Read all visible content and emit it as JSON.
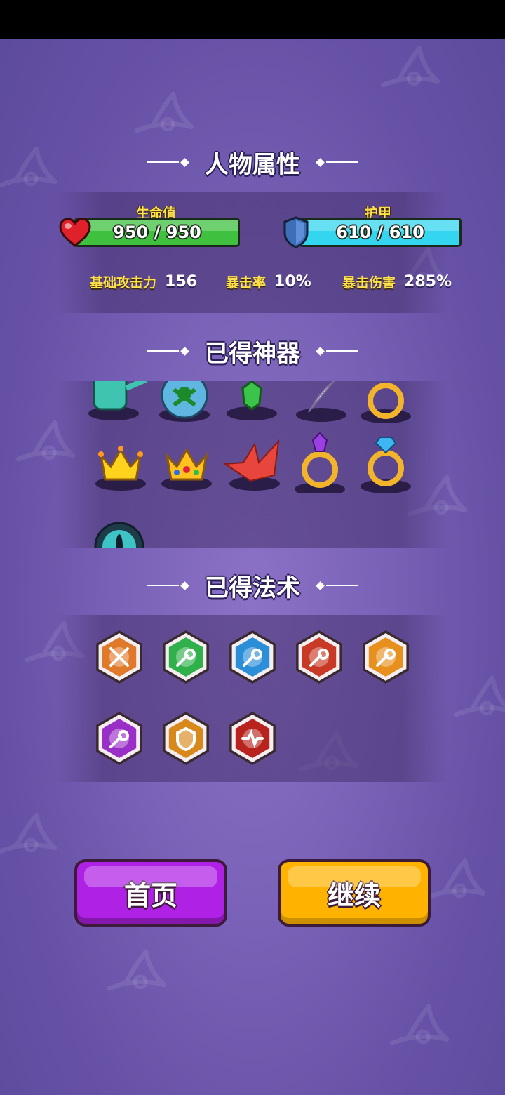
{
  "sections": {
    "attributes": "人物属性",
    "artifacts": "已得神器",
    "spells": "已得法术"
  },
  "health": {
    "label": "生命值",
    "value": "950 / 950",
    "fraction": 1.0,
    "color": "#3fc13f"
  },
  "armor": {
    "label": "护甲",
    "value": "610 / 610",
    "fraction": 1.0,
    "color": "#33d6ee"
  },
  "stats": [
    {
      "key": "基础攻击力",
      "value": "156"
    },
    {
      "key": "暴击率",
      "value": "10%"
    },
    {
      "key": "暴击伤害",
      "value": "285%"
    }
  ],
  "artifacts": [
    "watering-can-icon",
    "poison-orb-icon",
    "green-crystal-icon",
    "feather-icon",
    "gold-ring-icon",
    "gold-crown-icon",
    "jeweled-crown-icon",
    "paper-crane-icon",
    "amethyst-ring-icon",
    "diamond-ring-icon",
    "dragon-eye-icon"
  ],
  "spells": [
    {
      "icon": "crossed-swords-icon",
      "color": "#e07a2a"
    },
    {
      "icon": "green-comet-icon",
      "color": "#2fb04a"
    },
    {
      "icon": "blue-comet-icon",
      "color": "#2a8ed8"
    },
    {
      "icon": "red-comet-icon",
      "color": "#c93a26"
    },
    {
      "icon": "orange-comet-icon",
      "color": "#e8901e"
    },
    {
      "icon": "purple-comet-icon",
      "color": "#9a2fc8"
    },
    {
      "icon": "shield-icon",
      "color": "#d9891c"
    },
    {
      "icon": "heartbeat-icon",
      "color": "#b8231e"
    }
  ],
  "buttons": {
    "home": {
      "label": "首页",
      "color": "#b021e6"
    },
    "continue": {
      "label": "继续",
      "color": "#ffb300"
    }
  }
}
